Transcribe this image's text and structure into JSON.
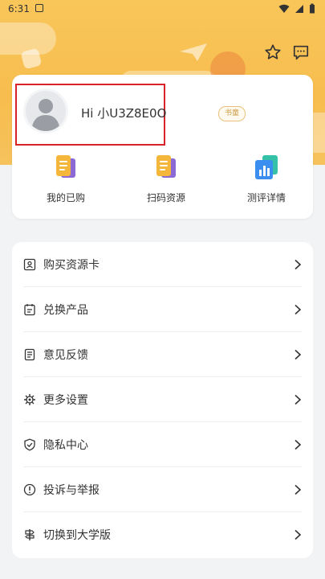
{
  "status_bar": {
    "time": "6:31"
  },
  "profile": {
    "greeting": "Hi 小U3Z8E0O",
    "badge": "书童"
  },
  "quick_actions": [
    {
      "label": "我的已购",
      "icon": "purchased-doc-icon"
    },
    {
      "label": "扫码资源",
      "icon": "scan-doc-icon"
    },
    {
      "label": "测评详情",
      "icon": "bar-chart-icon"
    }
  ],
  "menu": [
    {
      "label": "购买资源卡",
      "icon": "resource-card-icon"
    },
    {
      "label": "兑换产品",
      "icon": "exchange-icon"
    },
    {
      "label": "意见反馈",
      "icon": "feedback-icon"
    },
    {
      "label": "更多设置",
      "icon": "gear-icon"
    },
    {
      "label": "隐私中心",
      "icon": "shield-check-icon"
    },
    {
      "label": "投诉与举报",
      "icon": "alert-circle-icon"
    },
    {
      "label": "切换到大学版",
      "icon": "signpost-icon"
    }
  ],
  "colors": {
    "hero": "#f7bd4e",
    "highlight": "#d9232b",
    "icon_yellow": "#f5b73b",
    "icon_purple": "#8b6ad6",
    "icon_blue": "#3a8ef0",
    "icon_teal": "#35c0a8"
  }
}
